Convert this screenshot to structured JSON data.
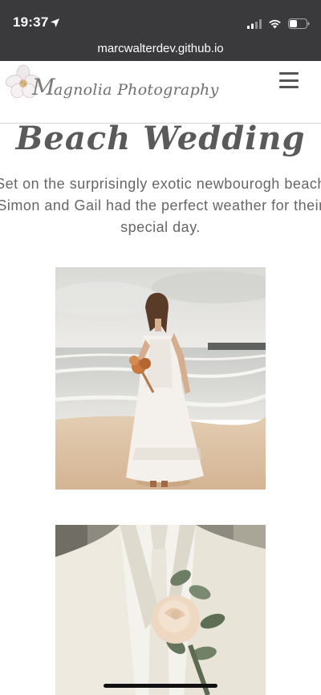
{
  "status_bar": {
    "time": "19:37",
    "icons": [
      "location-arrow-icon",
      "cellular-signal-icon",
      "wifi-icon",
      "battery-icon"
    ]
  },
  "browser": {
    "url": "marcwalterdev.github.io"
  },
  "header": {
    "logo_initial": "M",
    "logo_rest": "agnolia Photography",
    "menu_icon": "hamburger-menu-icon"
  },
  "main": {
    "title": "Beach Wedding",
    "description": "Set on the surprisingly exotic newbourogh beach Simon and Gail had the perfect weather for their special day.",
    "photos": [
      {
        "subject": "bride-on-beach"
      },
      {
        "subject": "groom-boutonniere"
      }
    ]
  },
  "colors": {
    "status_bar_bg": "#3a3a3c",
    "text_gray": "#666666",
    "title_gray": "#5a5a5a",
    "header_border": "#d6d6d6"
  }
}
